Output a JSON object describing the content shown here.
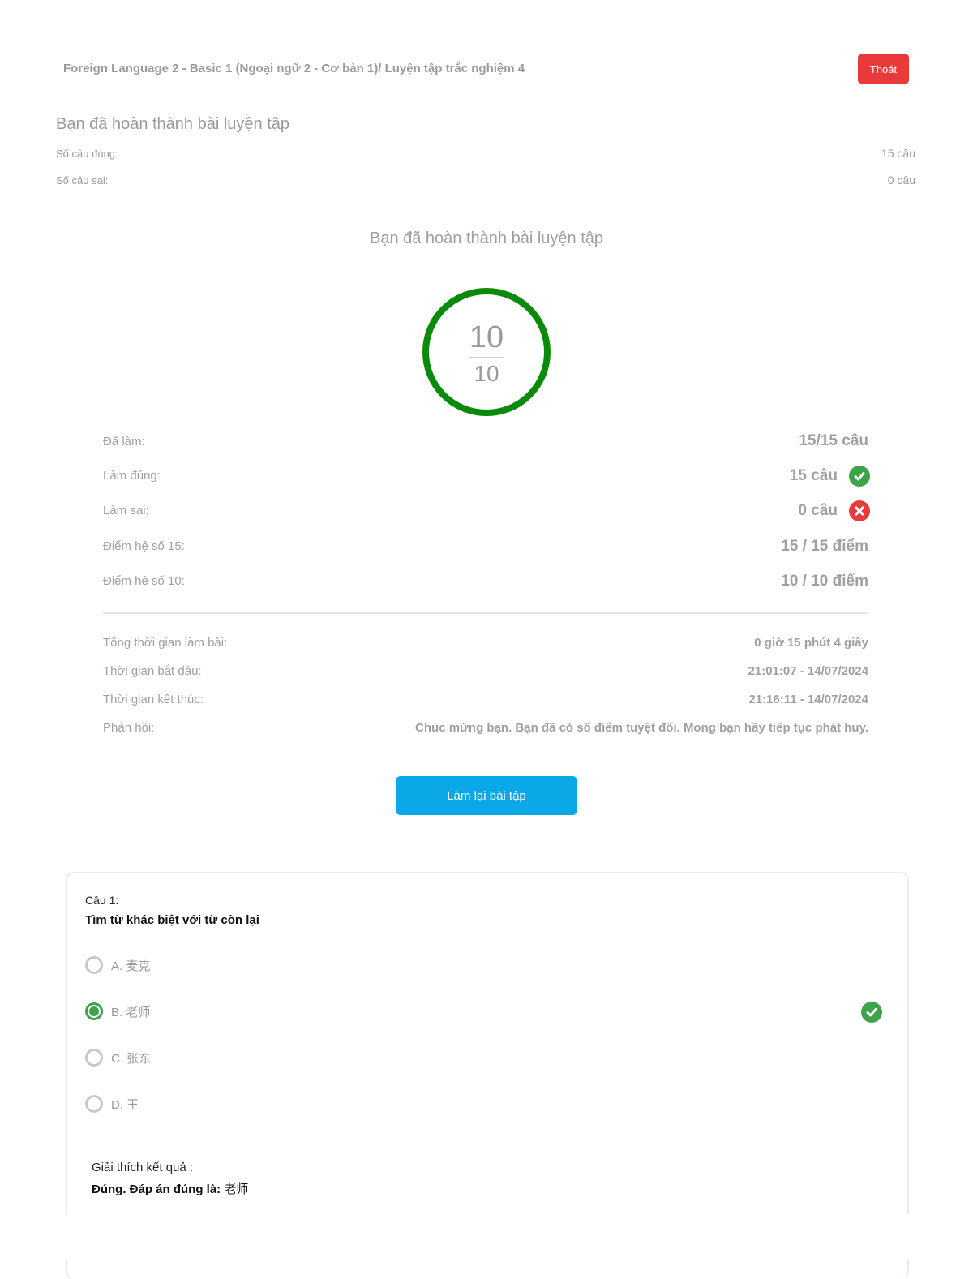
{
  "header": {
    "breadcrumb": "Foreign Language 2 - Basic 1 (Ngoại ngữ 2 - Cơ bản 1)/ Luyện tập trắc nghiệm 4",
    "exit_label": "Thoát"
  },
  "summary": {
    "title": "Bạn đã hoàn thành bài luyện tập",
    "correct_label": "Số câu đúng:",
    "correct_value": "15 câu",
    "wrong_label": "Số câu sai:",
    "wrong_value": "0 câu"
  },
  "result": {
    "title": "Bạn đã hoàn thành bài luyện tập",
    "score": "10",
    "score_max": "10",
    "ring_color": "#0a8a0a",
    "stats": {
      "done_label": "Đã làm:",
      "done_value": "15/15 câu",
      "correct_label": "Làm đúng:",
      "correct_value": "15 câu",
      "wrong_label": "Làm sai:",
      "wrong_value": "0 câu",
      "score15_label": "Điểm hệ số 15:",
      "score15_value": "15 / 15 điểm",
      "score10_label": "Điểm hệ số 10:",
      "score10_value": "10 / 10 điểm"
    },
    "info": {
      "total_time_label": "Tổng thời gian làm bài:",
      "total_time_value": "0 giờ 15 phút 4 giây",
      "start_label": "Thời gian bắt đầu:",
      "start_value": "21:01:07 - 14/07/2024",
      "end_label": "Thời gian kết thúc:",
      "end_value": "21:16:11 - 14/07/2024",
      "feedback_label": "Phản hồi:",
      "feedback_value": "Chúc mừng bạn. Bạn đã có số điểm tuyệt đối. Mong bạn hãy tiếp tục phát huy."
    },
    "retry_label": "Làm lại bài tập"
  },
  "question": {
    "number": "Câu 1:",
    "text": "Tìm từ khác biệt với từ còn lại",
    "options": [
      {
        "label": "A. 麦克",
        "selected": false
      },
      {
        "label": "B. 老师",
        "selected": true
      },
      {
        "label": "C. 张东",
        "selected": false
      },
      {
        "label": "D. 王",
        "selected": false
      }
    ],
    "explain_label": "Giải thích kết quả :",
    "explain_prefix": "Đúng. Đáp án đúng là:",
    "explain_answer": "老师"
  },
  "colors": {
    "correct": "#3fa34a",
    "wrong": "#e83a3a",
    "accent": "#0aa8e6"
  }
}
